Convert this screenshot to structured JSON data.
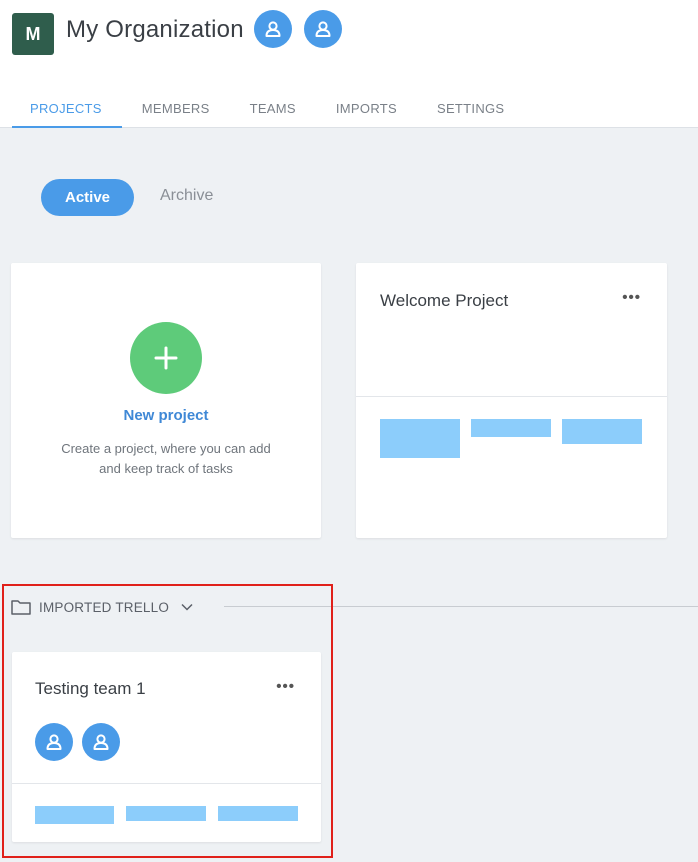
{
  "org": {
    "logo_letter": "M",
    "name": "My Organization"
  },
  "tabs": [
    {
      "label": "PROJECTS",
      "active": true
    },
    {
      "label": "MEMBERS"
    },
    {
      "label": "TEAMS"
    },
    {
      "label": "IMPORTS"
    },
    {
      "label": "SETTINGS"
    }
  ],
  "filter": {
    "active_label": "Active",
    "archive_label": "Archive"
  },
  "new_project": {
    "title": "New project",
    "description_line1": "Create a project, where you can add",
    "description_line2": "and keep track of tasks"
  },
  "welcome_project": {
    "title": "Welcome Project",
    "menu": "•••"
  },
  "section": {
    "label": "IMPORTED TRELLO"
  },
  "testing_project": {
    "title": "Testing team 1",
    "menu": "•••"
  },
  "icons": {
    "avatar": "user-avatar-icon",
    "plus": "plus-icon",
    "folder": "folder-icon",
    "chevron": "chevron-down-icon"
  },
  "colors": {
    "accent": "#4a9be8",
    "logo_bg": "#2f5d4c",
    "add_green": "#5ecb7a",
    "placeholder_bar": "#8ccdfb",
    "highlight": "#e0201a"
  }
}
